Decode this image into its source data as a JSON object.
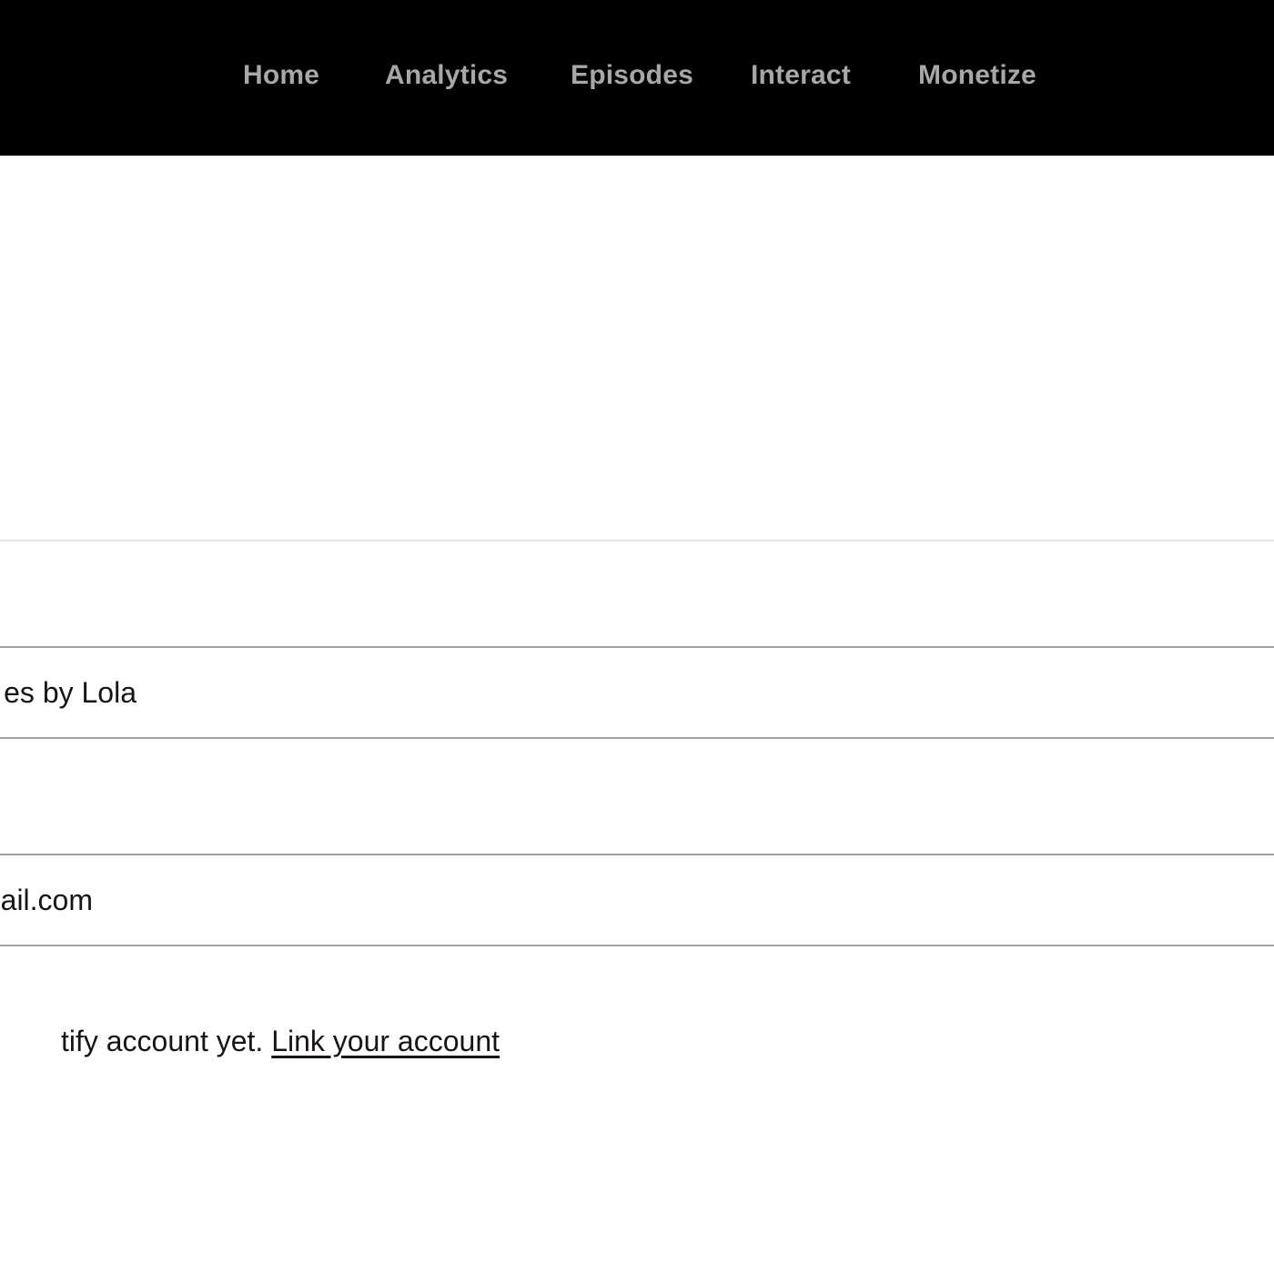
{
  "nav": {
    "items": [
      {
        "label": "Home"
      },
      {
        "label": "Analytics"
      },
      {
        "label": "Episodes"
      },
      {
        "label": "Interact"
      },
      {
        "label": "Monetize"
      }
    ]
  },
  "page": {
    "title_fragment": ":"
  },
  "fields": {
    "podcast_name_fragment": "es by Lola",
    "email_fragment": "ail.com"
  },
  "spotify_link": {
    "text_fragment": "tify account yet. ",
    "link_label": "Link your account"
  },
  "colors": {
    "nav_background": "#000000",
    "nav_text": "#a7a7a7",
    "body_text": "#191414",
    "border": "#a0a0a0"
  }
}
